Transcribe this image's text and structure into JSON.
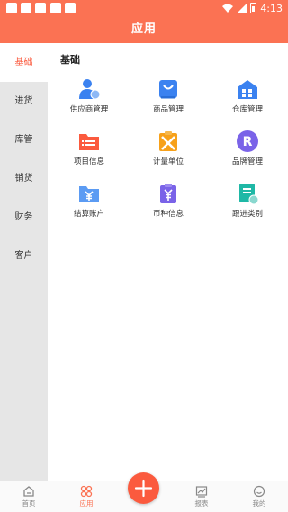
{
  "status_bar": {
    "time": "4:13",
    "icons": [
      "app-square-icon",
      "app-square-icon",
      "app-square-icon",
      "app-square-icon",
      "app-square-icon",
      "wifi-icon",
      "signal-icon",
      "battery-icon"
    ]
  },
  "header": {
    "title": "应用"
  },
  "sidebar": {
    "items": [
      {
        "label": "基础",
        "active": true
      },
      {
        "label": "进货"
      },
      {
        "label": "库管"
      },
      {
        "label": "销货"
      },
      {
        "label": "财务"
      },
      {
        "label": "客户"
      }
    ]
  },
  "main": {
    "section_title": "基础",
    "items": [
      {
        "label": "供应商管理",
        "icon": "supplier-icon",
        "color": "#3b82f0"
      },
      {
        "label": "商品管理",
        "icon": "shopping-bag-icon",
        "color": "#3b82f0"
      },
      {
        "label": "仓库管理",
        "icon": "warehouse-icon",
        "color": "#3b82f0"
      },
      {
        "label": "项目信息",
        "icon": "folder-icon",
        "color": "#fb5a3e"
      },
      {
        "label": "计量单位",
        "icon": "measure-icon",
        "color": "#f7a11a"
      },
      {
        "label": "品牌管理",
        "icon": "brand-icon",
        "color": "#7a63e8"
      },
      {
        "label": "结算账户",
        "icon": "account-folder-icon",
        "color": "#3b82f0"
      },
      {
        "label": "币种信息",
        "icon": "currency-icon",
        "color": "#7a63e8"
      },
      {
        "label": "跟进类别",
        "icon": "followup-icon",
        "color": "#1fb8a6"
      }
    ]
  },
  "tabbar": {
    "items": [
      {
        "label": "首页",
        "icon": "home-icon"
      },
      {
        "label": "应用",
        "icon": "apps-icon",
        "active": true
      },
      {
        "label": "",
        "icon": "plus-icon"
      },
      {
        "label": "报表",
        "icon": "report-icon"
      },
      {
        "label": "我的",
        "icon": "profile-icon"
      }
    ]
  },
  "colors": {
    "accent": "#fb7253",
    "fab": "#fb5a3e",
    "active_text": "#fb5a3e"
  }
}
